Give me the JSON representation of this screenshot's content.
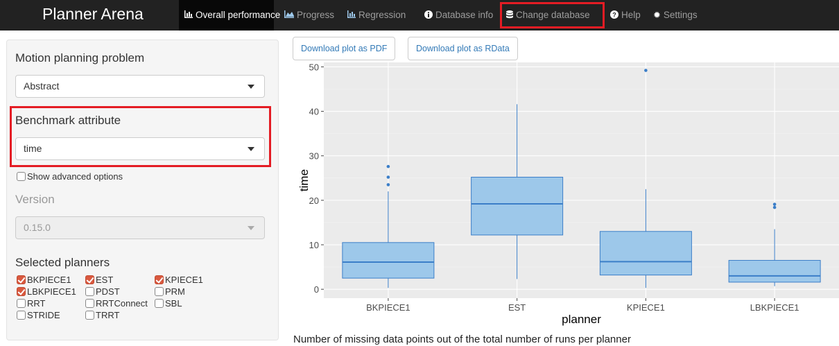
{
  "navbar": {
    "brand": "Planner Arena",
    "items": [
      {
        "label": "Overall performance",
        "icon": "bar-chart-icon",
        "active": true
      },
      {
        "label": "Progress",
        "icon": "area-chart-icon"
      },
      {
        "label": "Regression",
        "icon": "bar-chart-icon"
      },
      {
        "label": "Database info",
        "icon": "info-icon"
      },
      {
        "label": "Change database",
        "icon": "database-icon",
        "highlighted": true
      },
      {
        "label": "Help",
        "icon": "question-icon"
      },
      {
        "label": "Settings",
        "icon": "gear-icon"
      }
    ]
  },
  "sidebar": {
    "problem_label": "Motion planning problem",
    "problem_value": "Abstract",
    "attribute_label": "Benchmark attribute",
    "attribute_value": "time",
    "advanced_label": "Show advanced options",
    "version_label": "Version",
    "version_value": "0.15.0",
    "planners_label": "Selected planners",
    "planners": [
      {
        "name": "BKPIECE1",
        "checked": true
      },
      {
        "name": "EST",
        "checked": true
      },
      {
        "name": "KPIECE1",
        "checked": true
      },
      {
        "name": "LBKPIECE1",
        "checked": true
      },
      {
        "name": "PDST",
        "checked": false
      },
      {
        "name": "PRM",
        "checked": false
      },
      {
        "name": "RRT",
        "checked": false
      },
      {
        "name": "RRTConnect",
        "checked": false
      },
      {
        "name": "SBL",
        "checked": false
      },
      {
        "name": "STRIDE",
        "checked": false
      },
      {
        "name": "TRRT",
        "checked": false
      }
    ]
  },
  "main": {
    "download_pdf": "Download plot as PDF",
    "download_rdata": "Download plot as RData",
    "missing_note": "Number of missing data points out of the total number of runs per planner"
  },
  "colors": {
    "highlight": "#e41c24",
    "box_fill": "#9dc8ea",
    "box_stroke": "#3b7ec8",
    "panel_bg": "#ebebeb"
  },
  "chart_data": {
    "type": "box",
    "xlabel": "planner",
    "ylabel": "time",
    "ylim": [
      -2,
      51
    ],
    "yticks": [
      0,
      10,
      20,
      30,
      40,
      50
    ],
    "categories": [
      "BKPIECE1",
      "EST",
      "KPIECE1",
      "LBKPIECE1"
    ],
    "boxes": [
      {
        "min": 0.3,
        "q1": 2.5,
        "median": 6.1,
        "q3": 10.5,
        "max": 22,
        "outliers": [
          23.5,
          25.2,
          27.6
        ]
      },
      {
        "min": 2.3,
        "q1": 12.2,
        "median": 19.2,
        "q3": 25.2,
        "max": 41.6,
        "outliers": []
      },
      {
        "min": 0.3,
        "q1": 3.2,
        "median": 6.2,
        "q3": 13.0,
        "max": 22.5,
        "outliers": [
          49.2
        ]
      },
      {
        "min": 0.7,
        "q1": 1.6,
        "median": 3.0,
        "q3": 6.5,
        "max": 13.5,
        "outliers": [
          18.4,
          19.1
        ]
      }
    ],
    "grid": true
  }
}
